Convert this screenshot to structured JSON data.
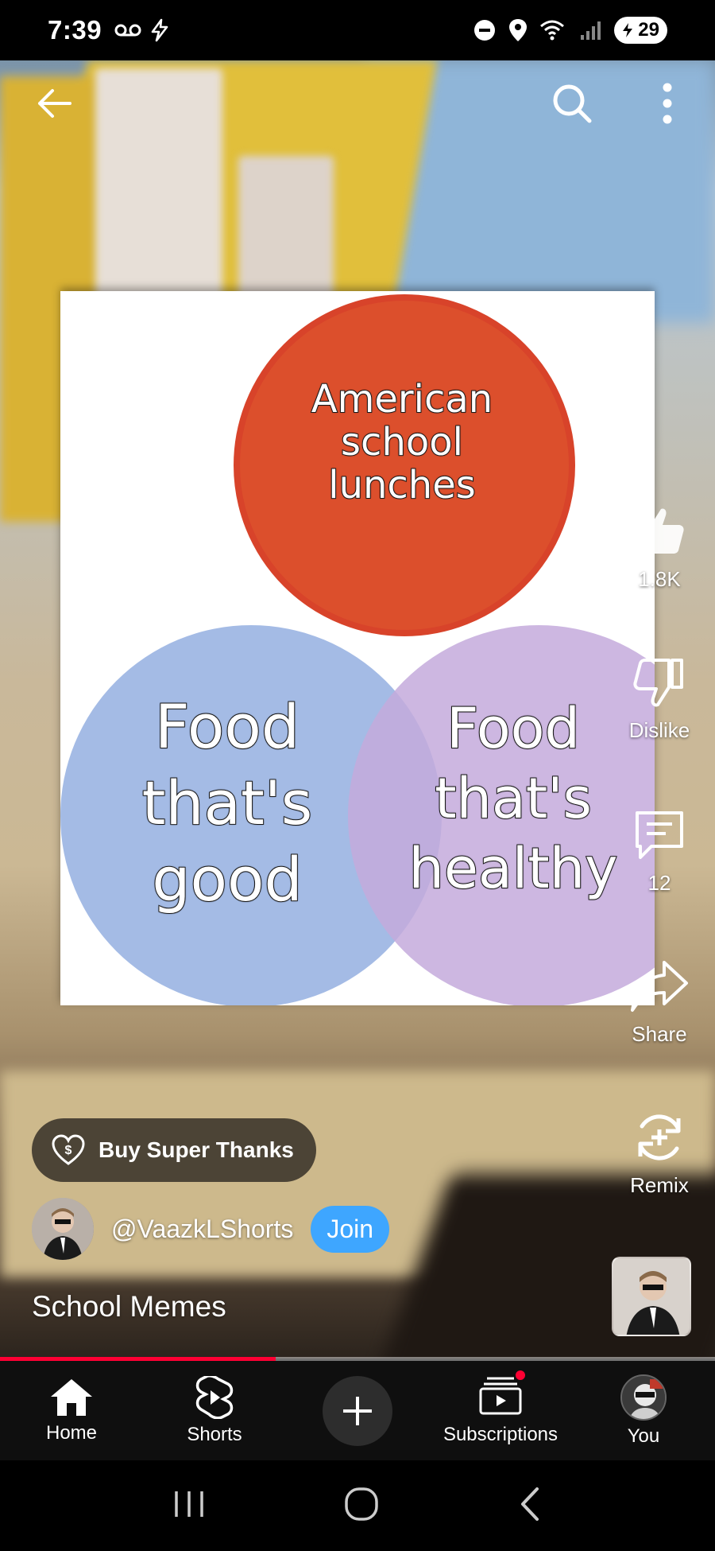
{
  "status_bar": {
    "time": "7:39",
    "battery": "29"
  },
  "video": {
    "meme": {
      "red_circle_text": "American school lunches",
      "blue_circle_text": "Food that's good",
      "purple_circle_text": "Food that's healthy"
    },
    "progress": 0.385
  },
  "rail": {
    "like_count": "1.8K",
    "dislike_label": "Dislike",
    "comment_count": "12",
    "share_label": "Share",
    "remix_label": "Remix"
  },
  "overlay": {
    "super_thanks_label": "Buy Super Thanks",
    "channel_handle": "@VaazkLShorts",
    "join_label": "Join",
    "video_title": "School Memes"
  },
  "bottom_nav": {
    "home": "Home",
    "shorts": "Shorts",
    "subscriptions": "Subscriptions",
    "you": "You"
  },
  "colors": {
    "accent_red": "#ff0033",
    "join_blue": "#3ea6ff"
  }
}
